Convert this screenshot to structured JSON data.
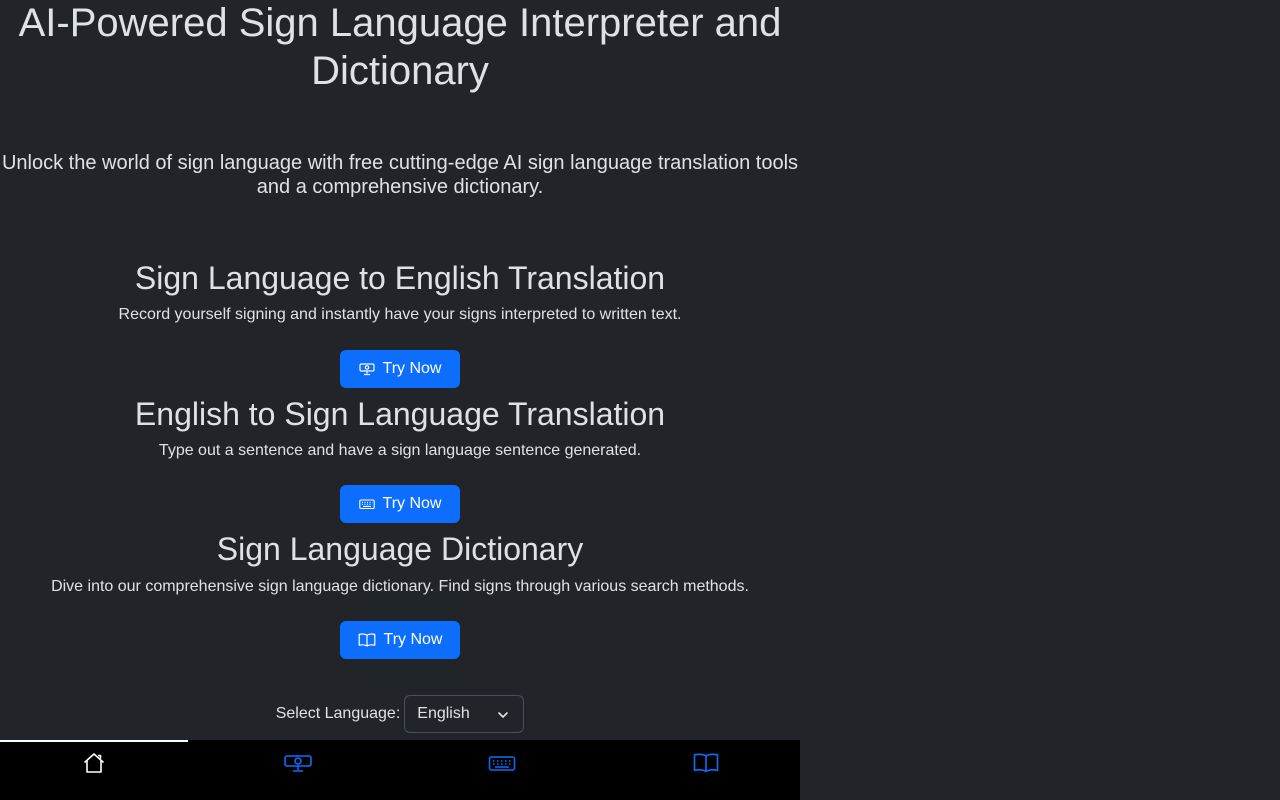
{
  "hero": {
    "title": "AI-Powered Sign Language Interpreter and Dictionary",
    "subtitle": "Unlock the world of sign language with free cutting-edge AI sign language translation tools and a comprehensive dictionary."
  },
  "features": [
    {
      "title": "Sign Language to English Translation",
      "description": "Record yourself signing and instantly have your signs interpreted to written text.",
      "button_label": "Try Now",
      "icon": "webcam-icon"
    },
    {
      "title": "English to Sign Language Translation",
      "description": "Type out a sentence and have a sign language sentence generated.",
      "button_label": "Try Now",
      "icon": "keyboard-icon"
    },
    {
      "title": "Sign Language Dictionary",
      "description": "Dive into our comprehensive sign language dictionary. Find signs through various search methods.",
      "button_label": "Try Now",
      "icon": "book-icon"
    }
  ],
  "language": {
    "label": "Select Language:",
    "selected": "English"
  },
  "bottom_nav": {
    "items": [
      {
        "name": "home",
        "icon": "home-icon",
        "active": true
      },
      {
        "name": "sign-to-english",
        "icon": "webcam-icon",
        "active": false
      },
      {
        "name": "english-to-sign",
        "icon": "keyboard-icon",
        "active": false
      },
      {
        "name": "dictionary",
        "icon": "book-icon",
        "active": false
      }
    ]
  },
  "colors": {
    "background": "#212529",
    "text": "#dee2e6",
    "primary": "#0d6efd",
    "nav_background": "#000000",
    "nav_icon": "#0d6efd",
    "nav_active": "#ffffff"
  }
}
